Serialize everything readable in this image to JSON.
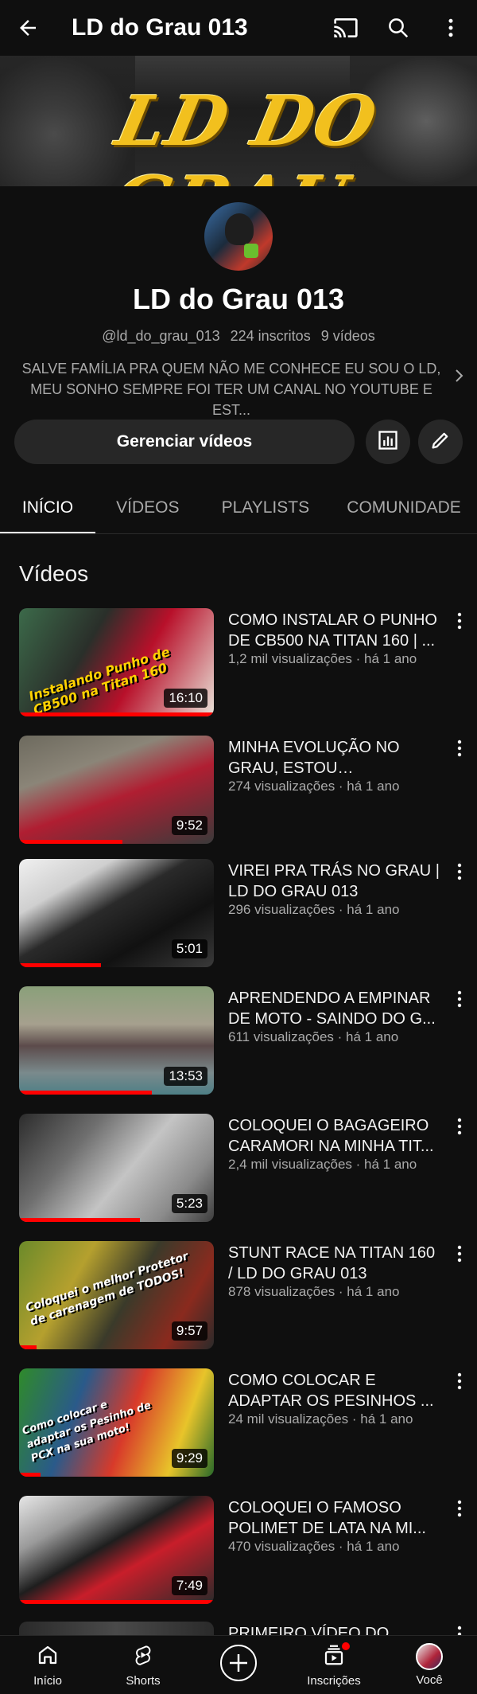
{
  "topbar": {
    "title": "LD do Grau 013",
    "icons": [
      "back-arrow-icon",
      "cast-icon",
      "search-icon",
      "more-vert-icon"
    ]
  },
  "banner": {
    "logo_text": "LD DO GRAU"
  },
  "channel": {
    "name": "LD do Grau 013",
    "handle": "@ld_do_grau_013",
    "subscribers": "224 inscritos",
    "videos_count": "9 vídeos",
    "description_line1": "SALVE FAMÍLIA PRA QUEM NÃO ME CONHECE EU SOU O LD,",
    "description_line2": "MEU SONHO SEMPRE FOI TER UM CANAL NO YOUTUBE E  EST..."
  },
  "actions": {
    "manage_label": "Gerenciar vídeos"
  },
  "tabs": [
    {
      "label": "INÍCIO",
      "active": true
    },
    {
      "label": "VÍDEOS",
      "active": false
    },
    {
      "label": "PLAYLISTS",
      "active": false
    },
    {
      "label": "COMUNIDADE",
      "active": false
    }
  ],
  "section_title": "Vídeos",
  "videos": [
    {
      "title": "COMO INSTALAR O PUNHO DE CB500 NA TITAN 160 | ...",
      "meta": "1,2 mil visualizações · há 1 ano",
      "duration": "16:10",
      "overlay": "Instalando Punho de CB500 na Titan 160",
      "progress": 1.0
    },
    {
      "title": "MINHA EVOLUÇÃO NO GRAU, ESTOU EVOLUINDO...",
      "meta": "274 visualizações · há 1 ano",
      "duration": "9:52",
      "overlay": "",
      "progress": 0.53
    },
    {
      "title": "VIREI PRA TRÁS NO GRAU | LD DO GRAU 013",
      "meta": "296 visualizações · há 1 ano",
      "duration": "5:01",
      "overlay": "",
      "progress": 0.42
    },
    {
      "title": "APRENDENDO A EMPINAR DE MOTO - SAINDO DO G...",
      "meta": "611 visualizações · há 1 ano",
      "duration": "13:53",
      "overlay": "",
      "progress": 0.68
    },
    {
      "title": "COLOQUEI O BAGAGEIRO CARAMORI NA MINHA TIT...",
      "meta": "2,4 mil visualizações · há 1 ano",
      "duration": "5:23",
      "overlay": "",
      "progress": 0.62
    },
    {
      "title": "STUNT RACE NA TITAN 160 / LD DO GRAU 013",
      "meta": "878 visualizações · há 1 ano",
      "duration": "9:57",
      "overlay": "Coloquei o melhor Protetor de carenagem de TODOS!",
      "progress": 0.09
    },
    {
      "title": "COMO COLOCAR E ADAPTAR OS PESINHOS ...",
      "meta": "24 mil visualizações · há 1 ano",
      "duration": "9:29",
      "overlay": "Como colocar e adaptar os Pesinho de PCX na sua moto!",
      "progress": 0.11
    },
    {
      "title": "COLOQUEI O FAMOSO POLIMET DE LATA NA MI...",
      "meta": "470 visualizações · há 1 ano",
      "duration": "7:49",
      "overlay": "",
      "progress": 1.0
    },
    {
      "title": "PRIMEIRO VÍDEO DO",
      "meta": "",
      "duration": "",
      "overlay": "",
      "progress": 0
    }
  ],
  "bottomnav": [
    {
      "label": "Início",
      "icon": "home-icon"
    },
    {
      "label": "Shorts",
      "icon": "shorts-icon"
    },
    {
      "label": "",
      "icon": "create-plus-icon"
    },
    {
      "label": "Inscrições",
      "icon": "subscriptions-icon"
    },
    {
      "label": "Você",
      "icon": "avatar-you"
    }
  ],
  "colors": {
    "background": "#0f0f0f",
    "accent_red": "#ff0000",
    "banner_gold": "#f2c01e",
    "muted_text": "#aaaaaa"
  }
}
